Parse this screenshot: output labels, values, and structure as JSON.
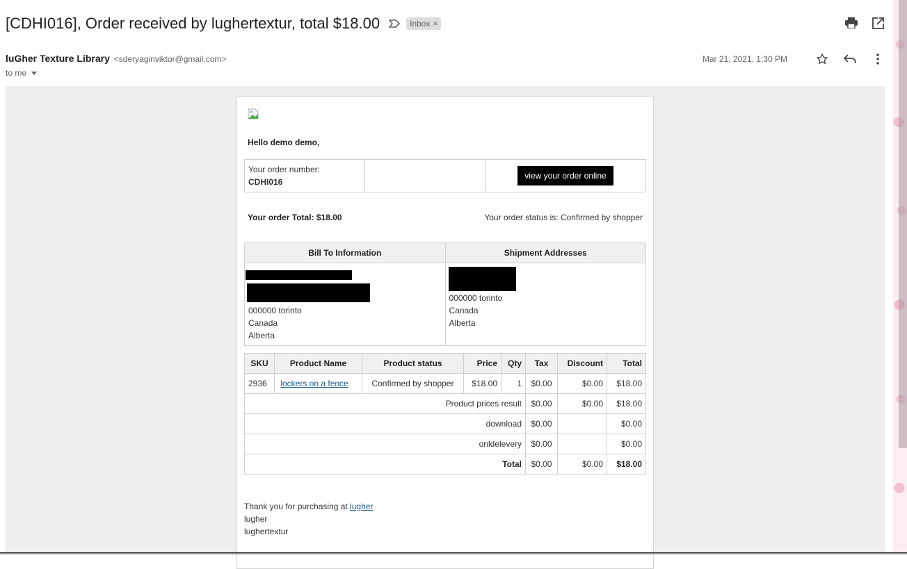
{
  "header": {
    "subject": "[CDHI016], Order received by lughertextur, total $18.00",
    "label_chip": "Inbox",
    "label_chip_close": "×",
    "icons": {
      "label": "label-important-icon",
      "print": "print-icon",
      "open_new_window": "open-in-new-icon"
    }
  },
  "sender": {
    "name": "luGher Texture Library",
    "email": "<sderyaginviktor@gmail.com>",
    "recipient": "to me",
    "date": "Mar 21, 2021, 1:30 PM",
    "icons": {
      "star": "star-icon",
      "reply": "reply-icon",
      "more": "more-vert-icon"
    }
  },
  "email": {
    "greeting": "Hello demo demo,",
    "order_number_label": "Your order number:",
    "order_number": "CDHI016",
    "view_order_button": "view your order online",
    "order_total": "Your order Total: $18.00",
    "order_status": "Your order status is: Confirmed by shopper",
    "addresses": {
      "bill_header": "Bill To Information",
      "ship_header": "Shipment Addresses",
      "bill_lines": [
        "000000 torinto",
        "Canada",
        "Alberta"
      ],
      "ship_lines": [
        "000000 torinto",
        "Canada",
        "Alberta"
      ]
    },
    "items": {
      "columns": [
        "SKU",
        "Product Name",
        "Product status",
        "Price",
        "Qty",
        "Tax",
        "Discount",
        "Total"
      ],
      "rows": [
        {
          "sku": "2936",
          "name": "lockers on a fence",
          "status": "Confirmed by shopper",
          "price": "$18.00",
          "qty": "1",
          "tax": "$0.00",
          "discount": "$0.00",
          "total": "$18.00"
        }
      ],
      "summary": [
        {
          "label": "Product prices result",
          "tax": "$0.00",
          "discount": "$0.00",
          "total": "$18.00"
        },
        {
          "label": "download",
          "tax": "$0.00",
          "discount": "",
          "total": "$0.00"
        },
        {
          "label": "onldelevery",
          "tax": "$0.00",
          "discount": "",
          "total": "$0.00"
        },
        {
          "label": "Total",
          "tax": "$0.00",
          "discount": "$0.00",
          "total": "$18.00"
        }
      ]
    },
    "footer": {
      "thanks_prefix": "Thank you for purchasing at ",
      "thanks_link": "lugher",
      "line2": "lugher",
      "line3": "lughertextur"
    }
  }
}
